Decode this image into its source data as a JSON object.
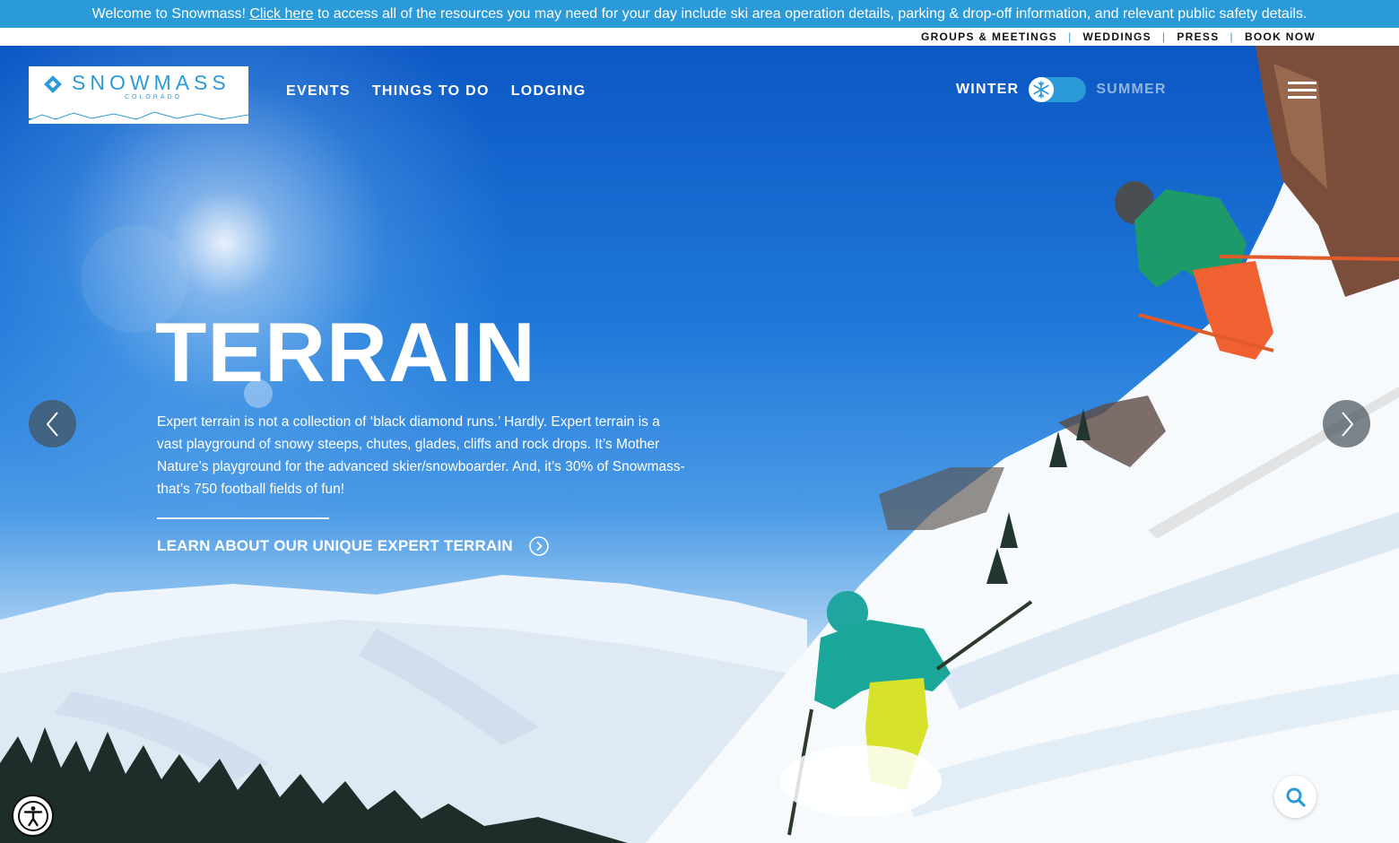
{
  "announcement": {
    "prefix": "Welcome to Snowmass! ",
    "link": "Click here",
    "suffix": " to access all of the resources you may need for your day include ski area operation details, parking & drop-off information, and relevant public safety details."
  },
  "utility_nav": [
    "GROUPS & MEETINGS",
    "WEDDINGS",
    "PRESS",
    "BOOK NOW"
  ],
  "logo": {
    "name": "SNOWMASS",
    "sub": "COLORADO"
  },
  "main_nav": [
    "EVENTS",
    "THINGS TO DO",
    "LODGING"
  ],
  "season_toggle": {
    "left": "WINTER",
    "right": "SUMMER",
    "selected": "WINTER"
  },
  "hero": {
    "title": "TERRAIN",
    "text": "Expert terrain is not a collection of ‘black diamond runs.’ Hardly. Expert terrain is a vast playground of snowy steeps, chutes, glades, cliffs and rock drops. It’s Mother Nature’s playground for the advanced skier/snowboarder. And, it’s 30% of Snowmass- that’s 750 football fields of fun!",
    "cta": "LEARN ABOUT OUR UNIQUE EXPERT TERRAIN"
  },
  "icons": {
    "prev": "chevron-left-icon",
    "next": "chevron-right-icon",
    "search": "search-icon",
    "accessibility": "accessibility-icon",
    "menu": "hamburger-menu-icon",
    "snowflake": "snowflake-icon",
    "cta_arrow": "circle-chevron-right-icon"
  },
  "colors": {
    "brand_blue": "#2b9ad8",
    "summer_inactive": "#8fb6da",
    "text_dark": "#111111"
  }
}
